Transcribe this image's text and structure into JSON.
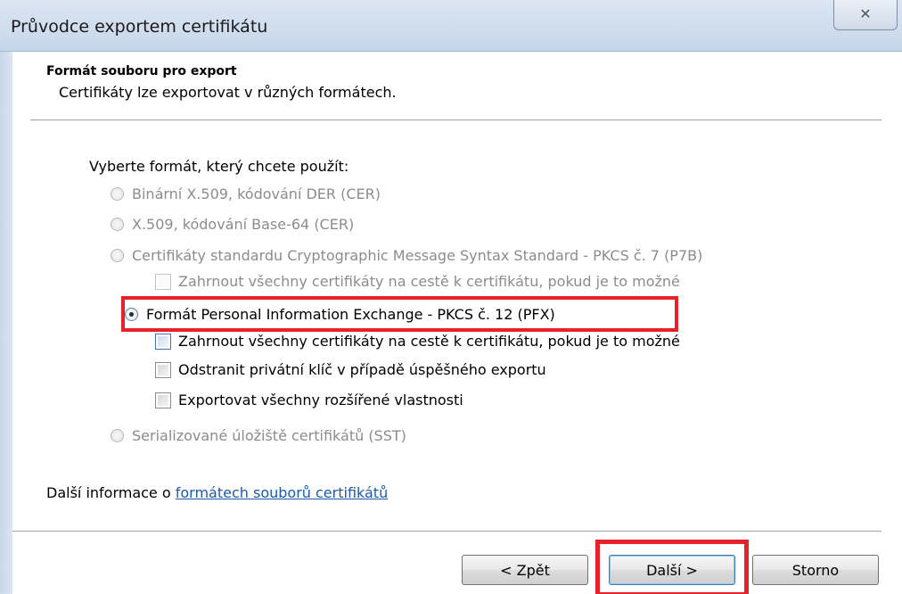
{
  "window": {
    "title": "Průvodce exportem certifikátu",
    "close_glyph": "✕"
  },
  "header": {
    "title": "Formát souboru pro export",
    "subtitle": "Certifikáty lze exportovat v různých formátech."
  },
  "prompt": "Vyberte formát, který chcete použít:",
  "options": {
    "der": "Binární X.509, kódování DER (CER)",
    "base64": "X.509, kódování Base-64 (CER)",
    "p7b": "Certifikáty standardu Cryptographic Message Syntax Standard - PKCS č. 7 (P7B)",
    "p7b_include": "Zahrnout všechny certifikáty na cestě k certifikátu, pokud je to možné",
    "pfx": "Formát Personal Information Exchange - PKCS č. 12 (PFX)",
    "pfx_include": "Zahrnout všechny certifikáty na cestě k certifikátu, pokud je to možné",
    "pfx_delete_key": "Odstranit privátní klíč v případě úspěšného exportu",
    "pfx_export_props": "Exportovat všechny rozšířené vlastnosti",
    "sst": "Serializované úložiště certifikátů (SST)"
  },
  "footer": {
    "prefix": "Další informace o ",
    "link": "formátech souborů certifikátů"
  },
  "buttons": {
    "back": "< Zpět",
    "next": "Další >",
    "cancel": "Storno"
  },
  "colors": {
    "highlight": "#e8202a",
    "link": "#1e5aa8"
  }
}
